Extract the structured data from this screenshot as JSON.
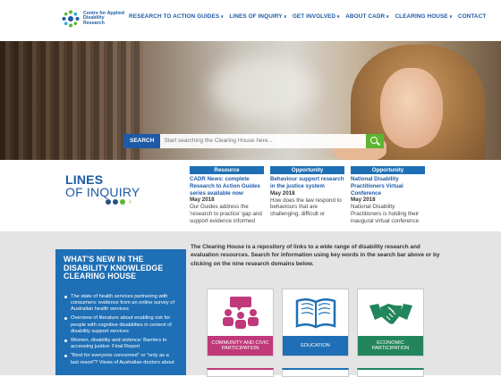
{
  "header": {
    "logo_text": "Centre for Applied Disability Research",
    "nav": [
      {
        "label": "RESEARCH TO ACTION GUIDES",
        "has_menu": true
      },
      {
        "label": "LINES OF INQUIRY",
        "has_menu": true
      },
      {
        "label": "GET INVOLVED",
        "has_menu": true
      },
      {
        "label": "ABOUT CADR",
        "has_menu": true
      },
      {
        "label": "CLEARING HOUSE",
        "has_menu": true
      },
      {
        "label": "CONTACT",
        "has_menu": false
      }
    ],
    "caret": "∨"
  },
  "search": {
    "label": "SEARCH",
    "placeholder": "Start searching the Clearing House here...",
    "button_icon": "search-icon"
  },
  "lines_of_inquiry": {
    "title_line1": "LINES",
    "title_line2": "OF INQUIRY",
    "arrow": "›",
    "cards": [
      {
        "tag": "Resource",
        "title": "CADR News: complete Research to Action Guides series available now",
        "date": "May 2018",
        "body": "Our Guides address the 'research to practice' gap and support evidence informed"
      },
      {
        "tag": "Opportunity",
        "title": "Behaviour support research in the justice system",
        "date": "May 2018",
        "body": "How does the law respond to behaviours that are challenging, difficult or"
      },
      {
        "tag": "Opportunity",
        "title": "National Disability Practitioners Virtual Conference",
        "date": "May 2018",
        "body": "National Disability Practitioners is holding their inaugural virtual conference"
      }
    ]
  },
  "whats_new": {
    "title": "WHAT'S NEW IN THE DISABILITY KNOWLEDGE CLEARING HOUSE",
    "items": [
      "The state of health services partnering with consumers: evidence from an online survey of Australian health services",
      "Overview of literature about enabling risk for people with cognitive disabilities in context of disability support services",
      "Women, disability and violence: Barriers to accessing justice: Final Report",
      "\"Best for everyone concerned\" or \"only as a last resort\"? Views of Australian doctors about"
    ]
  },
  "clearing_house": {
    "intro": "The Clearing House is a repository of links to a wide range of disability research and evaluation resources. Search for information using key words in the search bar above or by clicking on the nine research domains below.",
    "domains": [
      {
        "label": "COMMUNITY AND CIVIC PARTICIPATION",
        "icon": "community-icon",
        "color": "#c0397a"
      },
      {
        "label": "EDUCATION",
        "icon": "book-icon",
        "color": "#1e6fb5"
      },
      {
        "label": "ECONOMIC PARTICIPATION",
        "icon": "handshake-icon",
        "color": "#22855c"
      }
    ]
  }
}
